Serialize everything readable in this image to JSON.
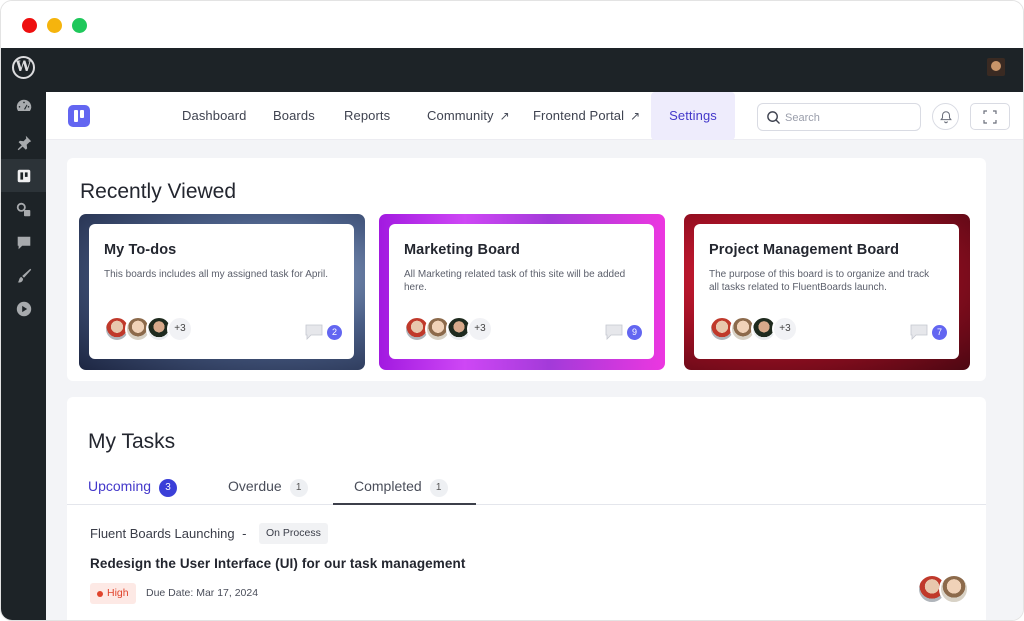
{
  "window": {
    "controls": [
      "close",
      "minimize",
      "maximize"
    ]
  },
  "wp_sidebar": {
    "icons": [
      "wordpress-logo-icon",
      "dashboard-icon",
      "pin-icon",
      "boards-icon",
      "media-icon",
      "comments-icon",
      "brush-icon",
      "play-icon"
    ]
  },
  "app_nav": {
    "items": [
      {
        "label": "Dashboard"
      },
      {
        "label": "Boards"
      },
      {
        "label": "Reports"
      },
      {
        "label": "Community",
        "external": true
      },
      {
        "label": "Frontend Portal",
        "external": true
      },
      {
        "label": "Settings",
        "active": true
      }
    ],
    "search_placeholder": "Search"
  },
  "recently_viewed": {
    "title": "Recently Viewed",
    "boards": [
      {
        "title": "My To-dos",
        "description": "This boards includes all my assigned task for April.",
        "more_members": "+3",
        "comments": "2"
      },
      {
        "title": "Marketing Board",
        "description": "All Marketing related task of this site will be added here.",
        "more_members": "+3",
        "comments": "9"
      },
      {
        "title": "Project Management Board",
        "description": "The purpose of this board is to organize and track all tasks related to FluentBoards launch.",
        "more_members": "+3",
        "comments": "7"
      }
    ]
  },
  "my_tasks": {
    "title": "My Tasks",
    "tabs": [
      {
        "label": "Upcoming",
        "count": "3",
        "active": true
      },
      {
        "label": "Overdue",
        "count": "1"
      },
      {
        "label": "Completed",
        "count": "1"
      }
    ],
    "task": {
      "board": "Fluent Boards Launching",
      "separator": "-",
      "status": "On Process",
      "title": "Redesign the User Interface (UI) for our task management",
      "priority": "High",
      "due_date": "Due Date: Mar 17, 2024"
    }
  },
  "colors": {
    "accent": "#6366f1",
    "wp_dark": "#1d2327",
    "priority_high": "#e0442c"
  }
}
